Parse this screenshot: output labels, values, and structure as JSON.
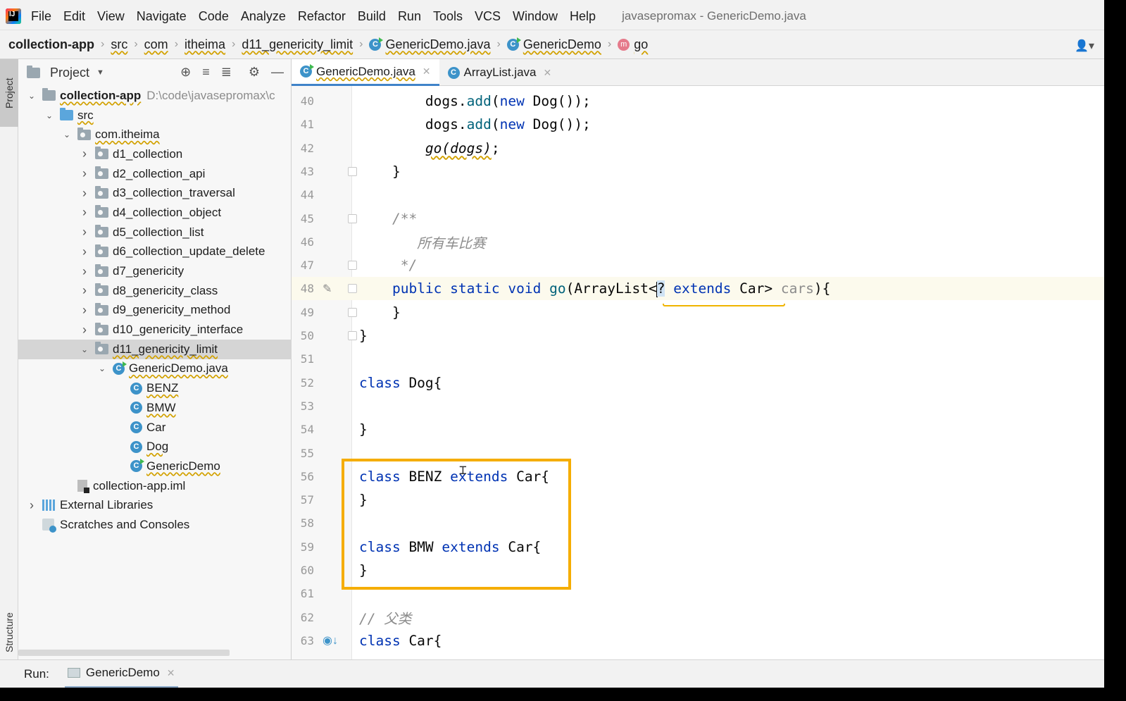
{
  "menubar": {
    "items": [
      "File",
      "Edit",
      "View",
      "Navigate",
      "Code",
      "Analyze",
      "Refactor",
      "Build",
      "Run",
      "Tools",
      "VCS",
      "Window",
      "Help"
    ],
    "mnemonics": [
      "F",
      "E",
      "V",
      "N",
      "C",
      "z",
      "R",
      "B",
      "u",
      "T",
      "S",
      "W",
      "H"
    ],
    "window_title": "javasepromax - GenericDemo.java"
  },
  "breadcrumb": [
    "collection-app",
    "src",
    "com",
    "itheima",
    "d11_genericity_limit",
    "GenericDemo.java",
    "GenericDemo",
    "go"
  ],
  "left_strip": {
    "project_tab": "Project",
    "structure_tab": "Structure"
  },
  "project_panel": {
    "title": "Project",
    "tree": [
      {
        "label": "collection-app",
        "path": "D:\\code\\javasepromax\\c",
        "depth": 0,
        "expanded": true,
        "icon": "module-folder"
      },
      {
        "label": "src",
        "depth": 1,
        "expanded": true,
        "icon": "source-folder"
      },
      {
        "label": "com.itheima",
        "depth": 2,
        "expanded": true,
        "icon": "package"
      },
      {
        "label": "d1_collection",
        "depth": 3,
        "expanded": false,
        "icon": "package"
      },
      {
        "label": "d2_collection_api",
        "depth": 3,
        "expanded": false,
        "icon": "package"
      },
      {
        "label": "d3_collection_traversal",
        "depth": 3,
        "expanded": false,
        "icon": "package"
      },
      {
        "label": "d4_collection_object",
        "depth": 3,
        "expanded": false,
        "icon": "package"
      },
      {
        "label": "d5_collection_list",
        "depth": 3,
        "expanded": false,
        "icon": "package"
      },
      {
        "label": "d6_collection_update_delete",
        "depth": 3,
        "expanded": false,
        "icon": "package"
      },
      {
        "label": "d7_genericity",
        "depth": 3,
        "expanded": false,
        "icon": "package"
      },
      {
        "label": "d8_genericity_class",
        "depth": 3,
        "expanded": false,
        "icon": "package"
      },
      {
        "label": "d9_genericity_method",
        "depth": 3,
        "expanded": false,
        "icon": "package"
      },
      {
        "label": "d10_genericity_interface",
        "depth": 3,
        "expanded": false,
        "icon": "package"
      },
      {
        "label": "d11_genericity_limit",
        "depth": 3,
        "expanded": true,
        "icon": "package",
        "selected": true
      },
      {
        "label": "GenericDemo.java",
        "depth": 4,
        "expanded": true,
        "icon": "class-runnable"
      },
      {
        "label": "BENZ",
        "depth": 5,
        "icon": "class"
      },
      {
        "label": "BMW",
        "depth": 5,
        "icon": "class"
      },
      {
        "label": "Car",
        "depth": 5,
        "icon": "class"
      },
      {
        "label": "Dog",
        "depth": 5,
        "icon": "class"
      },
      {
        "label": "GenericDemo",
        "depth": 5,
        "icon": "class-runnable"
      },
      {
        "label": "collection-app.iml",
        "depth": 2,
        "icon": "iml-file"
      },
      {
        "label": "External Libraries",
        "depth": 0,
        "expanded": false,
        "icon": "libraries"
      },
      {
        "label": "Scratches and Consoles",
        "depth": 0,
        "icon": "scratches"
      }
    ]
  },
  "editor_tabs": [
    {
      "label": "GenericDemo.java",
      "active": true
    },
    {
      "label": "ArrayList.java",
      "active": false
    }
  ],
  "code_lines": [
    {
      "n": "40",
      "text": "        dogs.add(new Dog());"
    },
    {
      "n": "41",
      "text": "        dogs.add(new Dog());"
    },
    {
      "n": "42",
      "text": "        go(dogs);"
    },
    {
      "n": "43",
      "text": "    }"
    },
    {
      "n": "44",
      "text": ""
    },
    {
      "n": "45",
      "text": "    /**"
    },
    {
      "n": "46",
      "text": "       所有车比赛"
    },
    {
      "n": "47",
      "text": "     */"
    },
    {
      "n": "48",
      "text": "    public static void go(ArrayList<? extends Car> cars){"
    },
    {
      "n": "49",
      "text": "    }"
    },
    {
      "n": "50",
      "text": "}"
    },
    {
      "n": "51",
      "text": ""
    },
    {
      "n": "52",
      "text": "class Dog{"
    },
    {
      "n": "53",
      "text": ""
    },
    {
      "n": "54",
      "text": "}"
    },
    {
      "n": "55",
      "text": ""
    },
    {
      "n": "56",
      "text": "class BENZ extends Car{"
    },
    {
      "n": "57",
      "text": "}"
    },
    {
      "n": "58",
      "text": ""
    },
    {
      "n": "59",
      "text": "class BMW extends Car{"
    },
    {
      "n": "60",
      "text": "}"
    },
    {
      "n": "61",
      "text": ""
    },
    {
      "n": "62",
      "text": "// 父类"
    },
    {
      "n": "63",
      "text": "class Car{"
    }
  ],
  "bottombar": {
    "run_label": "Run:",
    "run_tab": "GenericDemo"
  },
  "colors": {
    "keyword": "#0033b3",
    "method": "#00627a",
    "comment": "#8c8c8c",
    "highlight_box": "#f5ad00",
    "tab_accent": "#4083c9"
  }
}
